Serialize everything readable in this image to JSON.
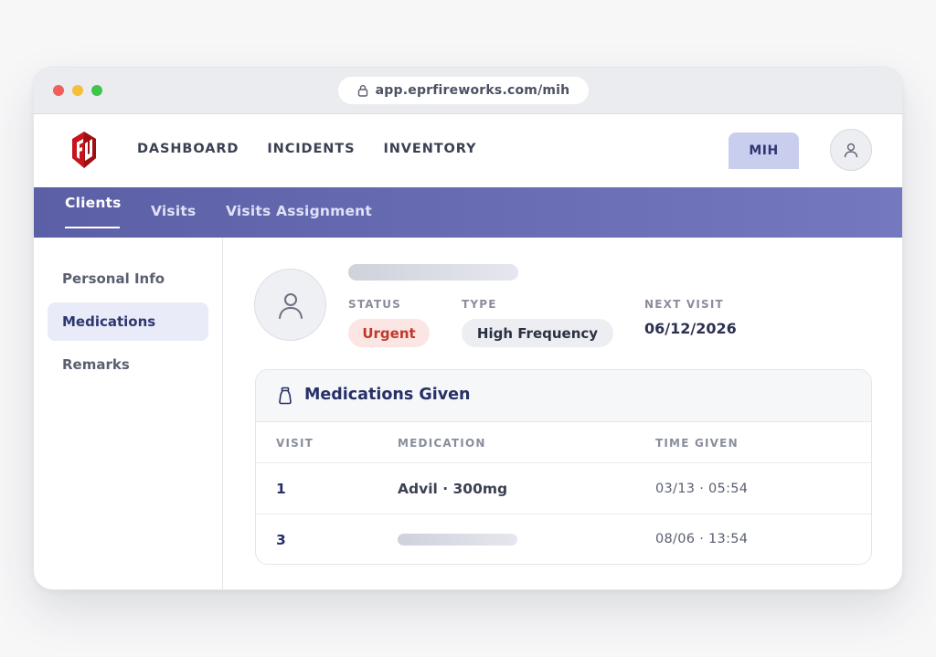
{
  "browser": {
    "url": "app.eprfireworks.com/mih"
  },
  "navbar": {
    "links": [
      "DASHBOARD",
      "INCIDENTS",
      "INVENTORY"
    ],
    "mih_label": "MIH"
  },
  "subnav": {
    "tabs": [
      "Clients",
      "Visits",
      "Visits Assignment"
    ],
    "active_tab": "Clients"
  },
  "sidebar": {
    "items": [
      "Personal Info",
      "Medications",
      "Remarks"
    ],
    "active_item": "Medications"
  },
  "client": {
    "status_label": "STATUS",
    "status_value": "Urgent",
    "type_label": "TYPE",
    "type_value": "High Frequency",
    "next_visit_label": "NEXT VISIT",
    "next_visit_value": "06/12/2026"
  },
  "medications": {
    "title": "Medications Given",
    "columns": [
      "VISIT",
      "MEDICATION",
      "TIME GIVEN"
    ],
    "rows": [
      {
        "visit": "1",
        "medication": "Advil · 300mg",
        "time": "03/13 · 05:54"
      },
      {
        "visit": "3",
        "medication": "",
        "time": "08/06 · 13:54"
      }
    ]
  },
  "colors": {
    "accent": "#5b5fa6",
    "urgent": "#c0392b",
    "brand_red": "#c8151b"
  }
}
